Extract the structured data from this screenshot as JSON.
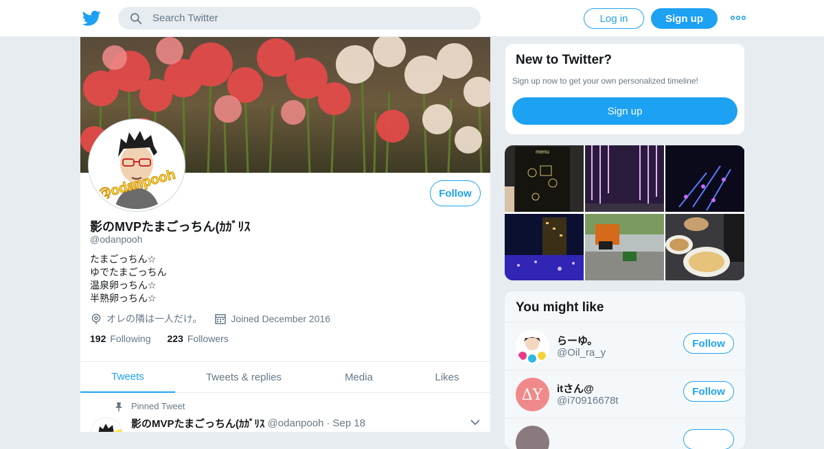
{
  "topbar": {
    "search_placeholder": "Search Twitter",
    "login_label": "Log in",
    "signup_label": "Sign up"
  },
  "profile": {
    "name": "影のMVPたまごっちん(ｶｶﾞﾘｽ",
    "handle": "@odanpooh",
    "follow_label": "Follow",
    "bio": [
      "たまごっちん☆",
      "ゆでたまごっちん",
      "温泉卵っちん☆",
      "半熟卵っちん☆"
    ],
    "location": "オレの隣は一人だけ。",
    "joined": "Joined December 2016",
    "following_count": "192",
    "following_label": "Following",
    "followers_count": "223",
    "followers_label": "Followers",
    "avatar_overlay_text": "@odanpooh"
  },
  "tabs": [
    "Tweets",
    "Tweets & replies",
    "Media",
    "Likes"
  ],
  "pinned_tweet": {
    "label": "Pinned Tweet",
    "name": "影のMVPたまごっちん(ｶｶﾞﾘｽ",
    "handle": "@odanpooh",
    "date": "Sep 18"
  },
  "new_to_twitter": {
    "title": "New to Twitter?",
    "subtitle": "Sign up now to get your own personalized timeline!",
    "button": "Sign up"
  },
  "media_tiles": [
    {
      "desc": "menu"
    },
    {
      "desc": ""
    },
    {
      "desc": ""
    },
    {
      "desc": ""
    },
    {
      "desc": ""
    },
    {
      "desc": ""
    }
  ],
  "you_might_like": {
    "title": "You might like",
    "users": [
      {
        "name": "らーゆ。",
        "handle": "@Oil_ra_y",
        "follow": "Follow"
      },
      {
        "name": "itさん@",
        "handle": "@i70916678t",
        "follow": "Follow"
      }
    ]
  },
  "colors": {
    "accent": "#1da1f2",
    "text": "#14171a",
    "muted": "#657786",
    "bg": "#e6ecf0"
  },
  "icons": [
    "twitter-bird-icon",
    "search-icon",
    "more-dots-icon",
    "location-pin-icon",
    "calendar-icon",
    "pin-icon",
    "chevron-down-icon"
  ]
}
